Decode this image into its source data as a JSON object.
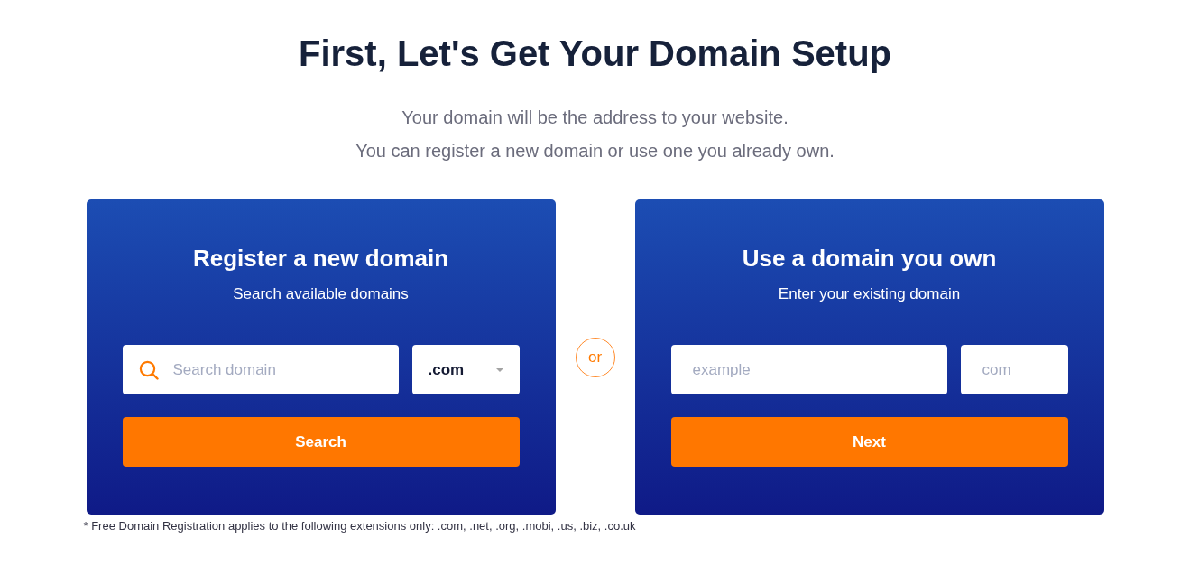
{
  "heading": "First, Let's Get Your Domain Setup",
  "intro": [
    "Your domain will be the address to your website.",
    "You can register a new domain or use one you already own."
  ],
  "options": [
    {
      "title": "Register a new domain",
      "subtitle": "Search available domains",
      "fields": [
        {
          "kind": "search",
          "placeholder": "Search domain"
        },
        {
          "kind": "select",
          "value": ".com"
        }
      ],
      "button": "Search"
    },
    {
      "title": "Use a domain you own",
      "subtitle": "Enter your existing domain",
      "fields": [
        {
          "kind": "text",
          "placeholder": "example"
        },
        {
          "kind": "text",
          "placeholder": "com"
        }
      ],
      "button": "Next"
    }
  ],
  "separator": "or",
  "footnote": "* Free Domain Registration applies to the following extensions only: .com, .net, .org, .mobi, .us, .biz, .co.uk"
}
